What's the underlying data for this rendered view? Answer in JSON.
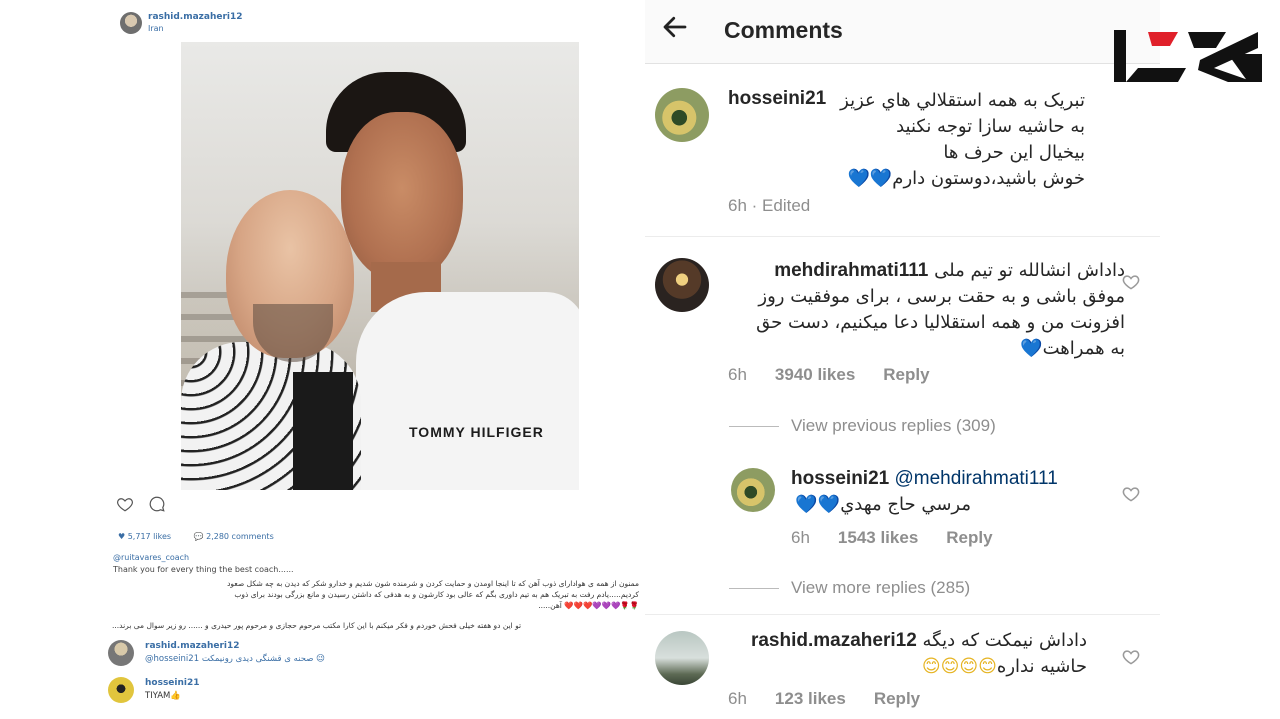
{
  "post": {
    "username": "rashid.mazaheri12",
    "location": "Iran",
    "shirt_text": "TOMMY HILFIGER",
    "likes": "5,717 likes",
    "comments_count": "2,280 comments",
    "caption_user": "@ruitavares_coach",
    "caption_en": "Thank you for every thing the best coach......",
    "caption_fa_lines": [
      "ممنون از همه ی هوادارای ذوب آهن که تا اینجا اومدن و حمایت کردن و شرمنده شون شدیم و خدارو شکر که دیدن به چه شکل صعود",
      "کردیم.....یادم رفت به تبریک هم به تیم داوری بگم که عالی بود کارشون و به هدفی که داشتن رسیدن و مانع بزرگی بودند برای ذوب",
      "آهن....."
    ],
    "caption_hearts": "🌹🌹💜💜💜❤️❤️❤️",
    "caption_fa2": "تو این دو هفته خیلی فحش خوردم و فکر میکنم با این کارا مکتب مرحوم حجازی و مرحوم پور حیدری و ...... رو زیر سوال می برند...",
    "mini_comments": [
      {
        "user": "rashid.mazaheri12",
        "text": "@hosseini21 صحنه ی قشنگی دیدی رونیمکت 😉"
      },
      {
        "user": "hosseini21",
        "text": "TIYAM👍"
      }
    ]
  },
  "comments_view": {
    "back_icon": "arrow-left-icon",
    "title": "Comments",
    "comments": [
      {
        "author": "hosseini21",
        "lines": [
          "تبریک به همه استقلالي هاي عزيز",
          "به حاشيه سازا توجه نكنيد",
          "بيخيال اين حرف ها",
          "خوش باشيد،دوستون دارم"
        ],
        "hearts": "💙💙",
        "time": "6h",
        "edited": "Edited"
      },
      {
        "author": "mehdirahmati111",
        "lines": [
          "داداش انشالله تو تیم ملی",
          "موفق باشی و به حقت برسی ، برای موفقیت روز",
          "افزونت من و همه استقلالیا دعا میکنیم، دست حق",
          "به همراهت"
        ],
        "hearts": "💙",
        "time": "6h",
        "likes": "3940 likes",
        "reply": "Reply"
      },
      {
        "author": "hosseini21",
        "mention": "@mehdirahmati111",
        "text": "مرسي حاج مهدي",
        "hearts": "💙💙",
        "time": "6h",
        "likes": "1543 likes",
        "reply": "Reply"
      },
      {
        "author": "rashid.mazaheri12",
        "lines": [
          "داداش نيمكت كه ديگه",
          "حاشیه نداره"
        ],
        "smiles": "😊😊😊😊",
        "time": "6h",
        "likes": "123 likes",
        "reply": "Reply"
      }
    ],
    "view_previous": "View previous replies (309)",
    "view_more": "View more replies (285)"
  },
  "colors": {
    "link_blue": "#3a6ea5",
    "meta_gray": "#8e8e8e",
    "logo_red": "#e0202a",
    "heart_teal": "#55b7d4"
  }
}
